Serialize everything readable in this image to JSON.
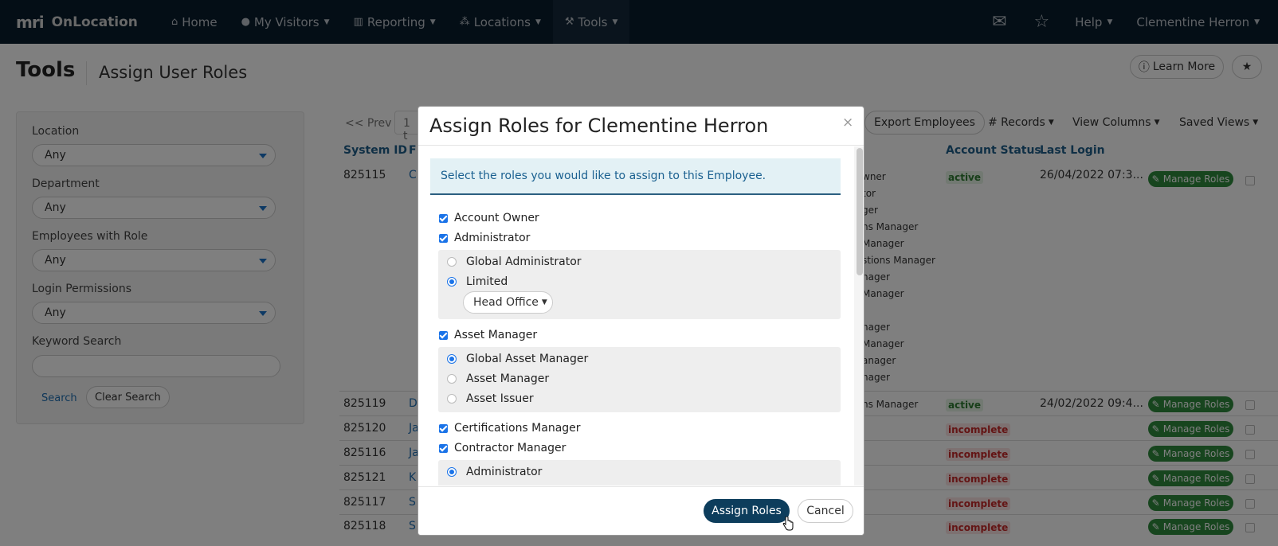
{
  "navbar": {
    "brand_logo": "mri",
    "brand_name": "OnLocation",
    "items": [
      {
        "label": "Home",
        "icon": "home-icon",
        "caret": false
      },
      {
        "label": "My Visitors",
        "icon": "user-icon",
        "caret": true
      },
      {
        "label": "Reporting",
        "icon": "bar-chart-icon",
        "caret": true
      },
      {
        "label": "Locations",
        "icon": "locations-icon",
        "caret": true
      },
      {
        "label": "Tools",
        "icon": "wrench-icon",
        "caret": true
      }
    ],
    "help": "Help",
    "user": "Clementine Herron"
  },
  "page": {
    "title": "Tools",
    "subtitle": "Assign User Roles",
    "learn_more": "Learn More"
  },
  "filters": {
    "location_label": "Location",
    "location_value": "Any",
    "department_label": "Department",
    "department_value": "Any",
    "role_label": "Employees with Role",
    "role_value": "Any",
    "login_label": "Login Permissions",
    "login_value": "Any",
    "keyword_label": "Keyword Search",
    "search": "Search",
    "clear": "Clear Search"
  },
  "table": {
    "prev": "<< Prev",
    "range": "1 t",
    "export": "Export Employees",
    "records": "# Records",
    "view_columns": "View Columns",
    "saved_views": "Saved Views",
    "headers": {
      "system_id": "System ID",
      "first": "F",
      "account_status": "Account Status",
      "last_login": "Last Login"
    },
    "manage_label": "Manage Roles",
    "row1_roles": [
      "wner",
      "tor",
      "ger",
      "ns Manager",
      "Manager",
      "stions Manager",
      "nager",
      "Manager",
      "",
      "nager",
      "Manager",
      "anager",
      "nager"
    ],
    "rows": [
      {
        "id": "825115",
        "first": "C",
        "status": "active",
        "login": "26/04/2022 07:3..."
      },
      {
        "id": "825119",
        "first": "D",
        "role": "ns Manager",
        "status": "active",
        "login": "24/02/2022 09:4..."
      },
      {
        "id": "825120",
        "first": "Ja",
        "status": "incomplete",
        "login": ""
      },
      {
        "id": "825116",
        "first": "Ja",
        "status": "incomplete",
        "login": ""
      },
      {
        "id": "825121",
        "first": "K",
        "status": "incomplete",
        "login": ""
      },
      {
        "id": "825117",
        "first": "S",
        "status": "incomplete",
        "login": ""
      },
      {
        "id": "825118",
        "first": "S",
        "status": "incomplete",
        "login": ""
      }
    ]
  },
  "modal": {
    "title": "Assign Roles for Clementine Herron",
    "close": "×",
    "info": "Select the roles you would like to assign to this Employee.",
    "roles": {
      "account_owner": "Account Owner",
      "administrator": "Administrator",
      "global_admin": "Global Administrator",
      "limited": "Limited",
      "head_office": "Head Office",
      "asset_manager": "Asset Manager",
      "global_asset_manager": "Global Asset Manager",
      "asset_manager_opt": "Asset Manager",
      "asset_issuer": "Asset Issuer",
      "certifications_manager": "Certifications Manager",
      "contractor_manager": "Contractor Manager",
      "contractor_admin": "Administrator"
    },
    "assign": "Assign Roles",
    "cancel": "Cancel"
  },
  "colors": {
    "navbar": "#081c2d",
    "primary_button": "#0d3d5c",
    "checkbox": "#1a73e8",
    "manage_button": "#2e8b3d"
  }
}
